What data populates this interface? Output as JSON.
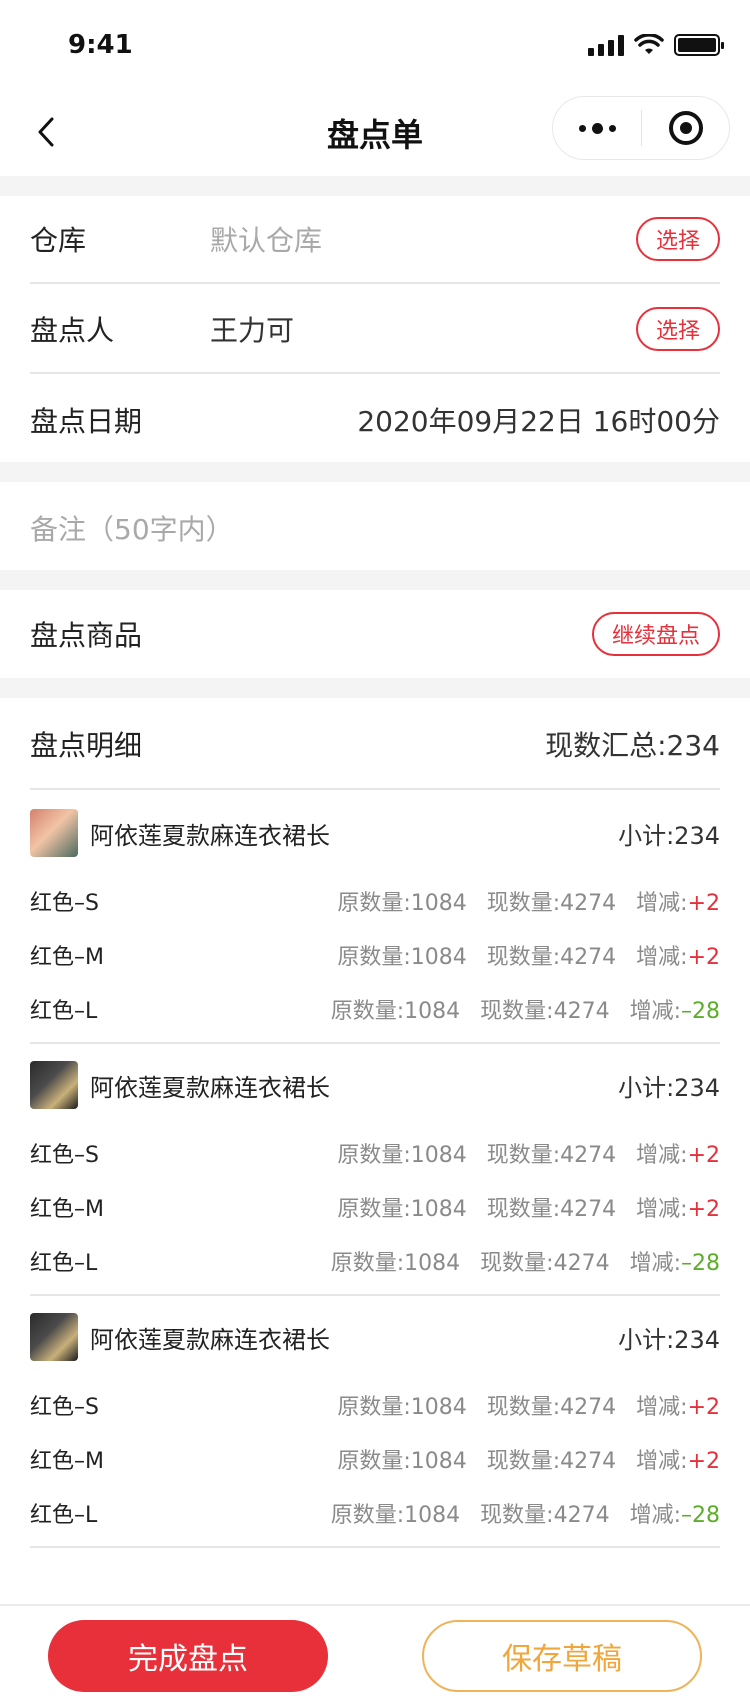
{
  "status_bar": {
    "time": "9:41"
  },
  "nav": {
    "title": "盘点单"
  },
  "form": {
    "warehouse": {
      "label": "仓库",
      "placeholder": "默认仓库",
      "button": "选择"
    },
    "counter": {
      "label": "盘点人",
      "value": "王力可",
      "button": "选择"
    },
    "date": {
      "label": "盘点日期",
      "value": "2020年09月22日 16时00分"
    },
    "remark_placeholder": "备注（50字内）",
    "goods": {
      "label": "盘点商品",
      "button": "继续盘点"
    }
  },
  "detail": {
    "title": "盘点明细",
    "total": "现数汇总:234",
    "groups": [
      {
        "name": "阿依莲夏款麻连衣裙长",
        "subtotal": "小计:234",
        "thumb": "dress-photo",
        "skus": [
          {
            "name": "红色–S",
            "orig": "原数量:1084",
            "curr": "现数量:4274",
            "delta_label": "增减:",
            "delta": "+2",
            "sign": "pos"
          },
          {
            "name": "红色–M",
            "orig": "原数量:1084",
            "curr": "现数量:4274",
            "delta_label": "增减:",
            "delta": "+2",
            "sign": "pos"
          },
          {
            "name": "红色–L",
            "orig": "原数量:1084",
            "curr": "现数量:4274",
            "delta_label": "增减:",
            "delta": "–28",
            "sign": "neg"
          }
        ]
      },
      {
        "name": "阿依莲夏款麻连衣裙长",
        "subtotal": "小计:234",
        "thumb": "jacket-photo",
        "skus": [
          {
            "name": "红色–S",
            "orig": "原数量:1084",
            "curr": "现数量:4274",
            "delta_label": "增减:",
            "delta": "+2",
            "sign": "pos"
          },
          {
            "name": "红色–M",
            "orig": "原数量:1084",
            "curr": "现数量:4274",
            "delta_label": "增减:",
            "delta": "+2",
            "sign": "pos"
          },
          {
            "name": "红色–L",
            "orig": "原数量:1084",
            "curr": "现数量:4274",
            "delta_label": "增减:",
            "delta": "–28",
            "sign": "neg"
          }
        ]
      },
      {
        "name": "阿依莲夏款麻连衣裙长",
        "subtotal": "小计:234",
        "thumb": "jacket-photo",
        "skus": [
          {
            "name": "红色–S",
            "orig": "原数量:1084",
            "curr": "现数量:4274",
            "delta_label": "增减:",
            "delta": "+2",
            "sign": "pos"
          },
          {
            "name": "红色–M",
            "orig": "原数量:1084",
            "curr": "现数量:4274",
            "delta_label": "增减:",
            "delta": "+2",
            "sign": "pos"
          },
          {
            "name": "红色–L",
            "orig": "原数量:1084",
            "curr": "现数量:4274",
            "delta_label": "增减:",
            "delta": "–28",
            "sign": "neg"
          }
        ]
      }
    ]
  },
  "footer": {
    "finish": "完成盘点",
    "draft": "保存草稿"
  },
  "colors": {
    "accent_red": "#e8303a",
    "draft_orange": "#f0a63a",
    "positive": "#e8303a",
    "negative": "#5bae2a"
  }
}
